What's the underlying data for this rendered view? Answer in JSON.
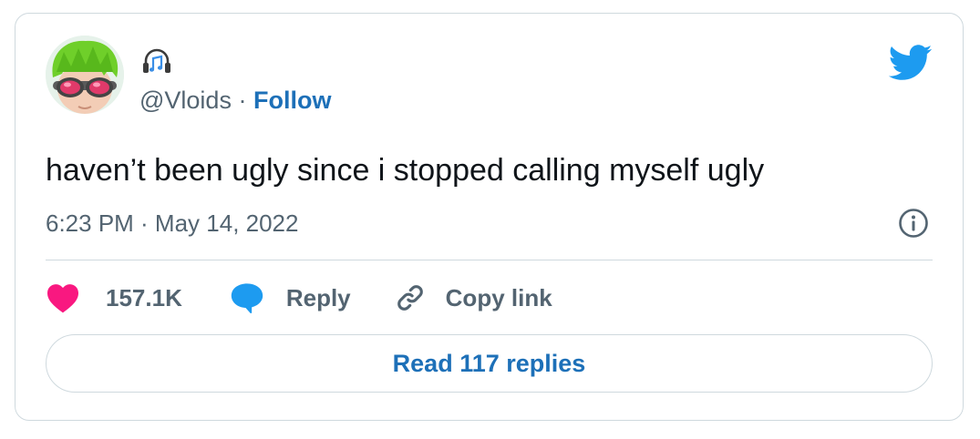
{
  "user": {
    "handle": "@Vloids",
    "separator": "·",
    "follow_label": "Follow"
  },
  "icons": {
    "avatar": "avatar-image",
    "name_emoji": "headphones-music-icon",
    "logo": "twitter-bird-icon",
    "info": "info-icon",
    "like": "heart-icon",
    "reply": "speech-bubble-icon",
    "copy": "link-icon"
  },
  "tweet": {
    "text": "haven’t been ugly since i stopped calling myself ugly",
    "timestamp": "6:23 PM · May 14, 2022"
  },
  "actions": {
    "like_count": "157.1K",
    "reply_label": "Reply",
    "copy_label": "Copy link"
  },
  "replies_button": {
    "label": "Read 117 replies"
  },
  "colors": {
    "brand_blue": "#1d9bf0",
    "link_blue": "#1d70b8",
    "heart_pink": "#f91880",
    "text_primary": "#0f1419",
    "text_secondary": "#536471",
    "border": "#cfd9de"
  }
}
